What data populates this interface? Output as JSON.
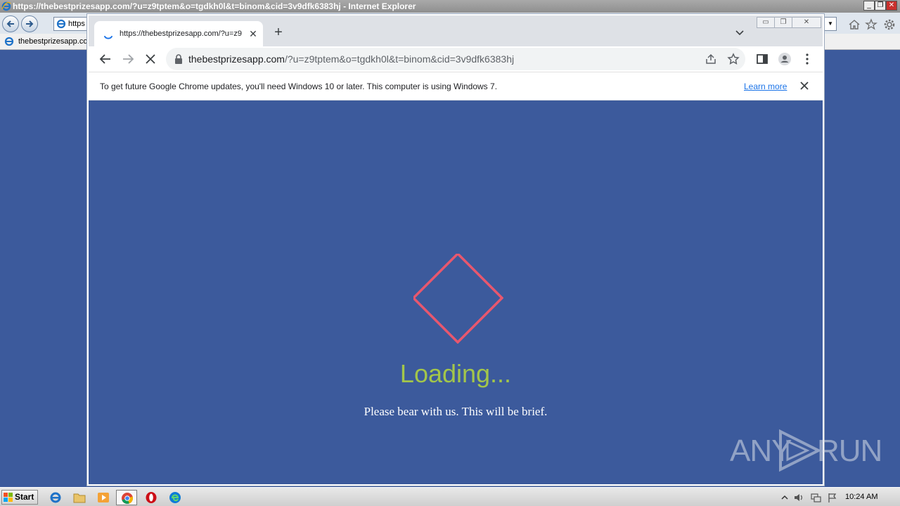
{
  "ie": {
    "title": "https://thebestprizesapp.com/?u=z9tptem&o=tgdkh0l&t=binom&cid=3v9dfk6383hj - Internet Explorer",
    "address_text": "https",
    "favorite_label": "thebestprizesapp.co",
    "controls": {
      "minimize": "_",
      "maximize": "❐",
      "close": "✕"
    }
  },
  "chrome": {
    "tab_title": "https://thebestprizesapp.com/?u=z9",
    "tab_close": "✕",
    "new_tab": "+",
    "url_host": "thebestprizesapp.com",
    "url_rest": "/?u=z9tptem&o=tgdkh0l&t=binom&cid=3v9dfk6383hj",
    "infobar": {
      "message": "To get future Google Chrome updates, you'll need Windows 10 or later. This computer is using Windows 7.",
      "link": "Learn more"
    },
    "window_controls": {
      "minimize": "▭",
      "restore": "❐",
      "close": "✕"
    }
  },
  "page": {
    "loading_text": "Loading...",
    "sub_text": "Please bear with us. This will be brief.",
    "diamond_color": "#e8576e",
    "loading_color": "#a3c64a",
    "background": "#3c5a9c"
  },
  "watermark": {
    "left": "ANY",
    "right": "RUN"
  },
  "taskbar": {
    "start_label": "Start",
    "clock": "10:24 AM",
    "apps": [
      "internet-explorer",
      "file-explorer",
      "media-player",
      "chrome",
      "opera",
      "edge"
    ]
  }
}
